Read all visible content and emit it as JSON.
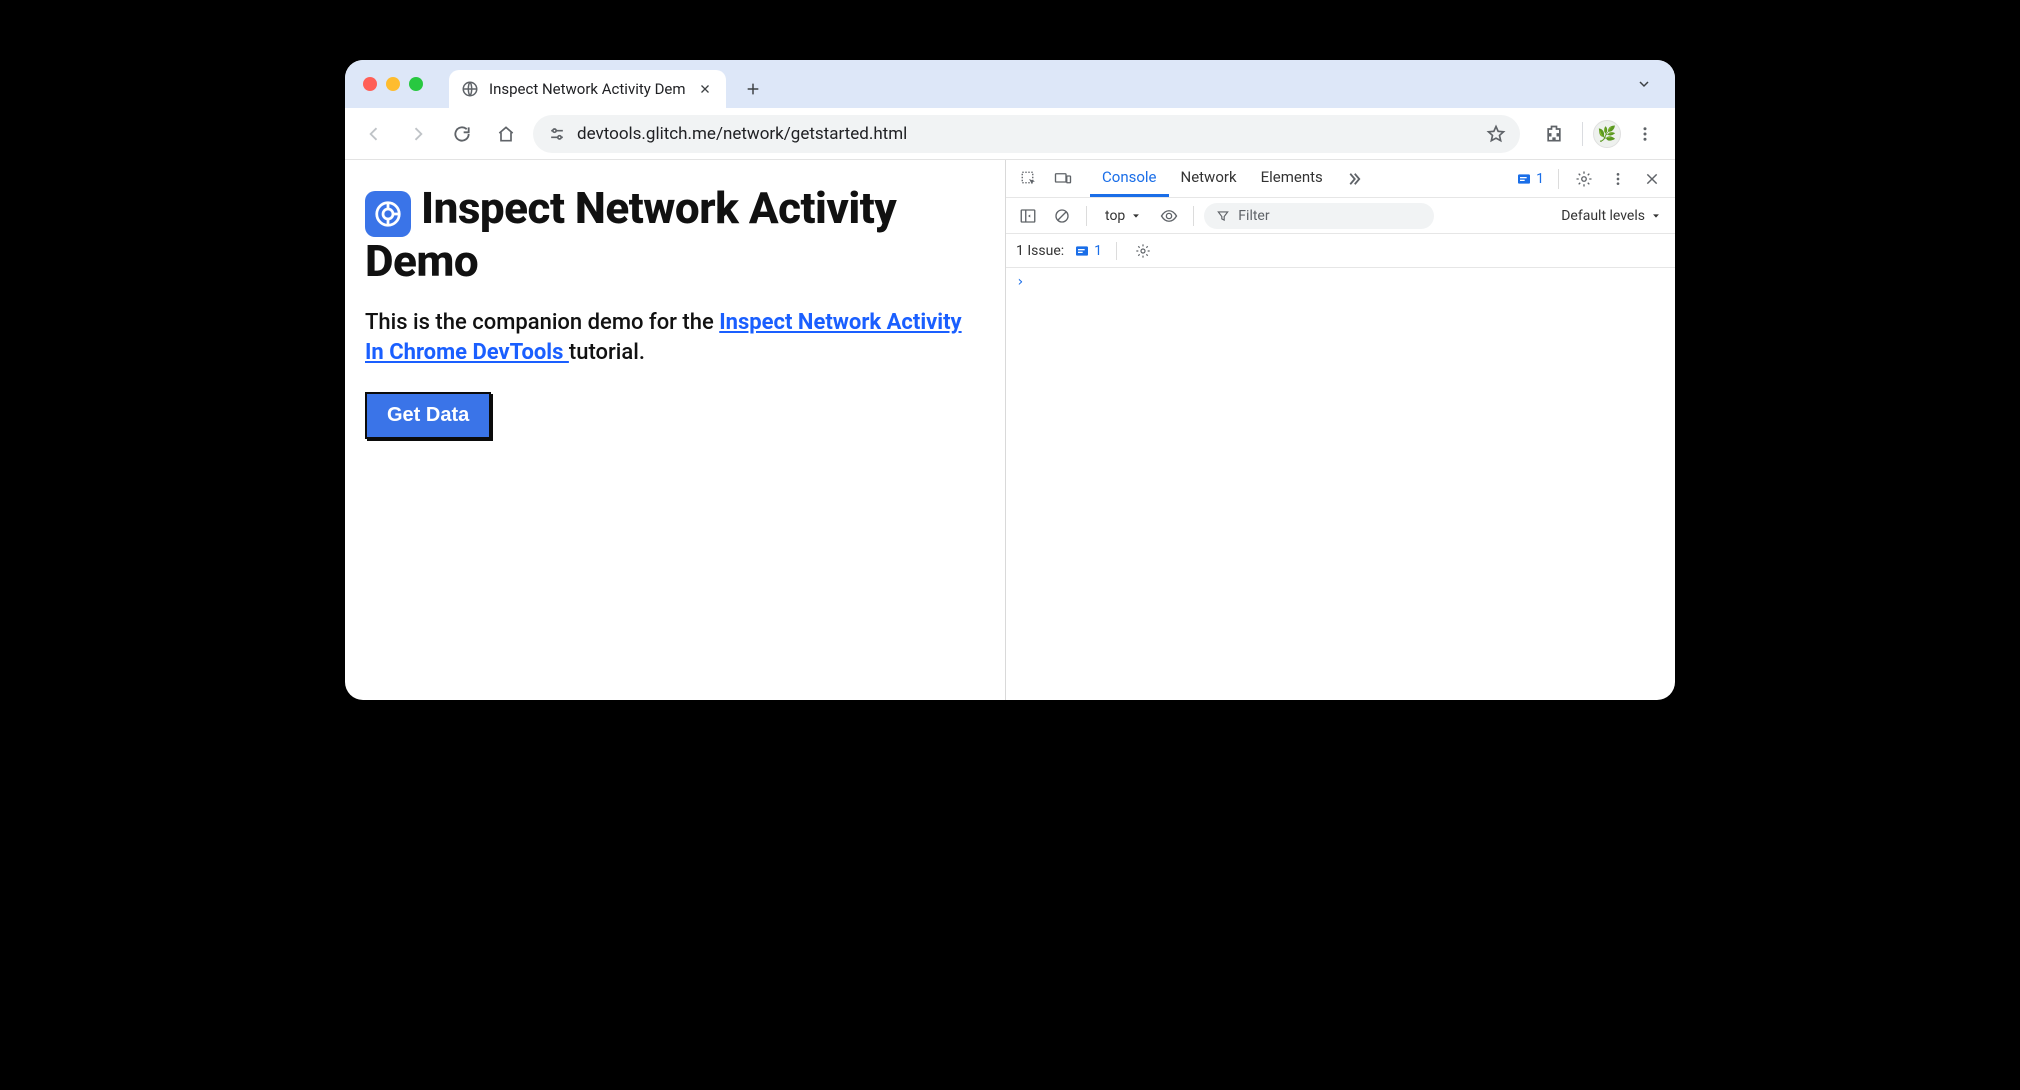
{
  "browser": {
    "tab_title": "Inspect Network Activity Dem",
    "url": "devtools.glitch.me/network/getstarted.html"
  },
  "page": {
    "heading": "Inspect Network Activity Demo",
    "intro_prefix": "This is the companion demo for the ",
    "intro_link": "Inspect Network Activity In Chrome DevTools ",
    "intro_suffix": "tutorial.",
    "button_label": "Get Data"
  },
  "devtools": {
    "tabs": {
      "console": "Console",
      "network": "Network",
      "elements": "Elements"
    },
    "issues_badge_count": "1",
    "context_label": "top",
    "filter_placeholder": "Filter",
    "levels_label": "Default levels",
    "issues_label": "1 Issue:",
    "issues_count": "1",
    "prompt": "›"
  }
}
